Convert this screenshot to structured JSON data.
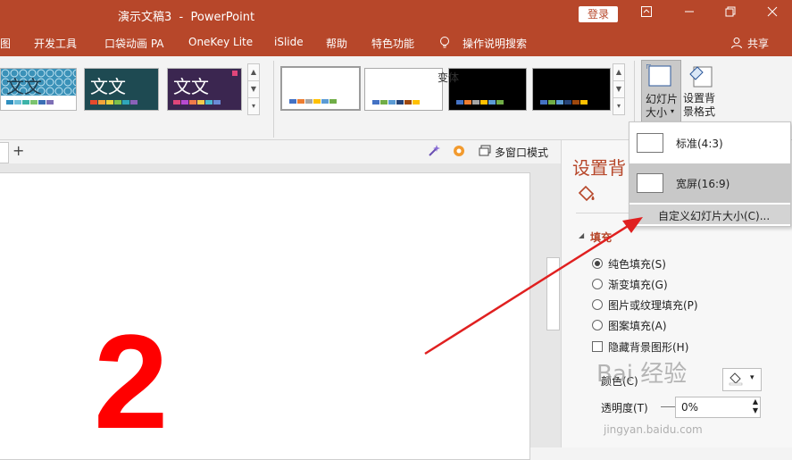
{
  "window": {
    "title": "演示文稿3  -  PowerPoint",
    "login_label": "登录",
    "controls": [
      "ribbon-display-icon",
      "minimize-icon",
      "restore-icon",
      "close-icon"
    ]
  },
  "ribbon_tabs": {
    "items": [
      {
        "label": "图"
      },
      {
        "label": "开发工具"
      },
      {
        "label": "口袋动画 PA"
      },
      {
        "label": "OneKey Lite"
      },
      {
        "label": "iSlide"
      },
      {
        "label": "帮助"
      },
      {
        "label": "特色功能"
      },
      {
        "label": "操作说明搜索"
      }
    ],
    "share_label": "共享"
  },
  "themes": {
    "items": [
      {
        "text": "文文"
      },
      {
        "text": "文文"
      },
      {
        "text": "文文"
      }
    ]
  },
  "variants": {
    "group_label": "变体"
  },
  "customize": {
    "slide_size_label_1": "幻灯片",
    "slide_size_label_2": "大小",
    "format_bg_label_1": "设置背",
    "format_bg_label_2": "景格式"
  },
  "subtoolbar": {
    "multiwindow_label": "多窗口模式"
  },
  "slide": {
    "big_number": "2"
  },
  "dropdown": {
    "items": [
      {
        "label": "标准(4:3)"
      },
      {
        "label": "宽屏(16:9)"
      },
      {
        "label": "自定义幻灯片大小(C)..."
      }
    ]
  },
  "format_pane": {
    "title": "设置背",
    "section_label": "填充",
    "options": [
      {
        "label": "纯色填充(S)",
        "selected": true
      },
      {
        "label": "渐变填充(G)",
        "selected": false
      },
      {
        "label": "图片或纹理填充(P)",
        "selected": false
      },
      {
        "label": "图案填充(A)",
        "selected": false
      }
    ],
    "hide_bg_label": "隐藏背景图形(H)",
    "color_label": "颜色(C)",
    "transparency_label": "透明度(T)",
    "transparency_value": "0%"
  },
  "watermark": {
    "text": "Bai 经验",
    "url": "jingyan.baidu.com"
  },
  "colors": {
    "accent": "#b7472a",
    "arrow": "#e02020",
    "big_number": "#ff0000"
  }
}
